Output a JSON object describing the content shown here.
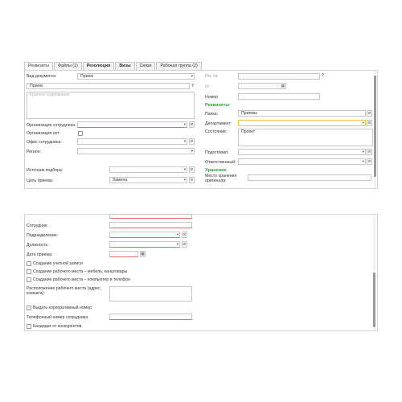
{
  "tabs": [
    {
      "label": "Реквизиты"
    },
    {
      "label": "Файлы (1)"
    },
    {
      "label": "Резолюции"
    },
    {
      "label": "Визы"
    },
    {
      "label": "Связи"
    },
    {
      "label": "Рабочая группа (2)"
    }
  ],
  "form": {
    "doc_type_label": "Вид документа",
    "doc_type_value": "Прием",
    "subject_value": "Прием",
    "content_placeholder": "Краткое содержание",
    "reg_no_label": "Рег. №",
    "from_label": "от",
    "number_label": "Номер",
    "org_employee_label": "Организация сотрудника:",
    "org_na_label": "Организация нет",
    "office_label": "Офис сотрудника:",
    "region_label": "Регион:",
    "source_label": "Источник подбора:",
    "goal_label": "Цель приема:",
    "goal_value": "Замена",
    "question_mark": "?"
  },
  "requisites": {
    "title": "Реквизиты",
    "folder_label": "Папка:",
    "folder_value": "Приемы",
    "department_label": "Департамент:",
    "state_label": "Состояние:",
    "state_value": "Проект",
    "prepared_label": "Подготовил:",
    "responsible_label": "Ответственный:"
  },
  "storage": {
    "title": "Хранение",
    "place_label": "Место хранения оригинала:"
  },
  "lower": {
    "employee_label": "Сотрудник:",
    "division_label": "Подразделение:",
    "position_label": "Должность:",
    "hire_date_label": "Дата приема:",
    "create_account_label": "Создание учетной записи",
    "create_workplace_furniture_label": "Создание рабочего места – мебель, канцтовары",
    "create_workplace_pc_label": "Создание рабочего места – компьютер и телефон",
    "workplace_location_label": "Расположение рабочего места (адрес, комната):",
    "corp_number_label": "Выдать корпоративный номер",
    "phone_label": "Телефонный номер сотрудника",
    "competitor_label": "Кандидат от конкурентов"
  },
  "icons": {
    "dropdown": "chevron-down-icon",
    "link": "link-icon",
    "calendar": "calendar-icon",
    "help": "question-icon"
  },
  "colors": {
    "accent_green": "#2e9e3a",
    "required_red": "#e06a6a",
    "focus_yellow": "#e8c64a",
    "help_blue": "#1a6fd1"
  }
}
